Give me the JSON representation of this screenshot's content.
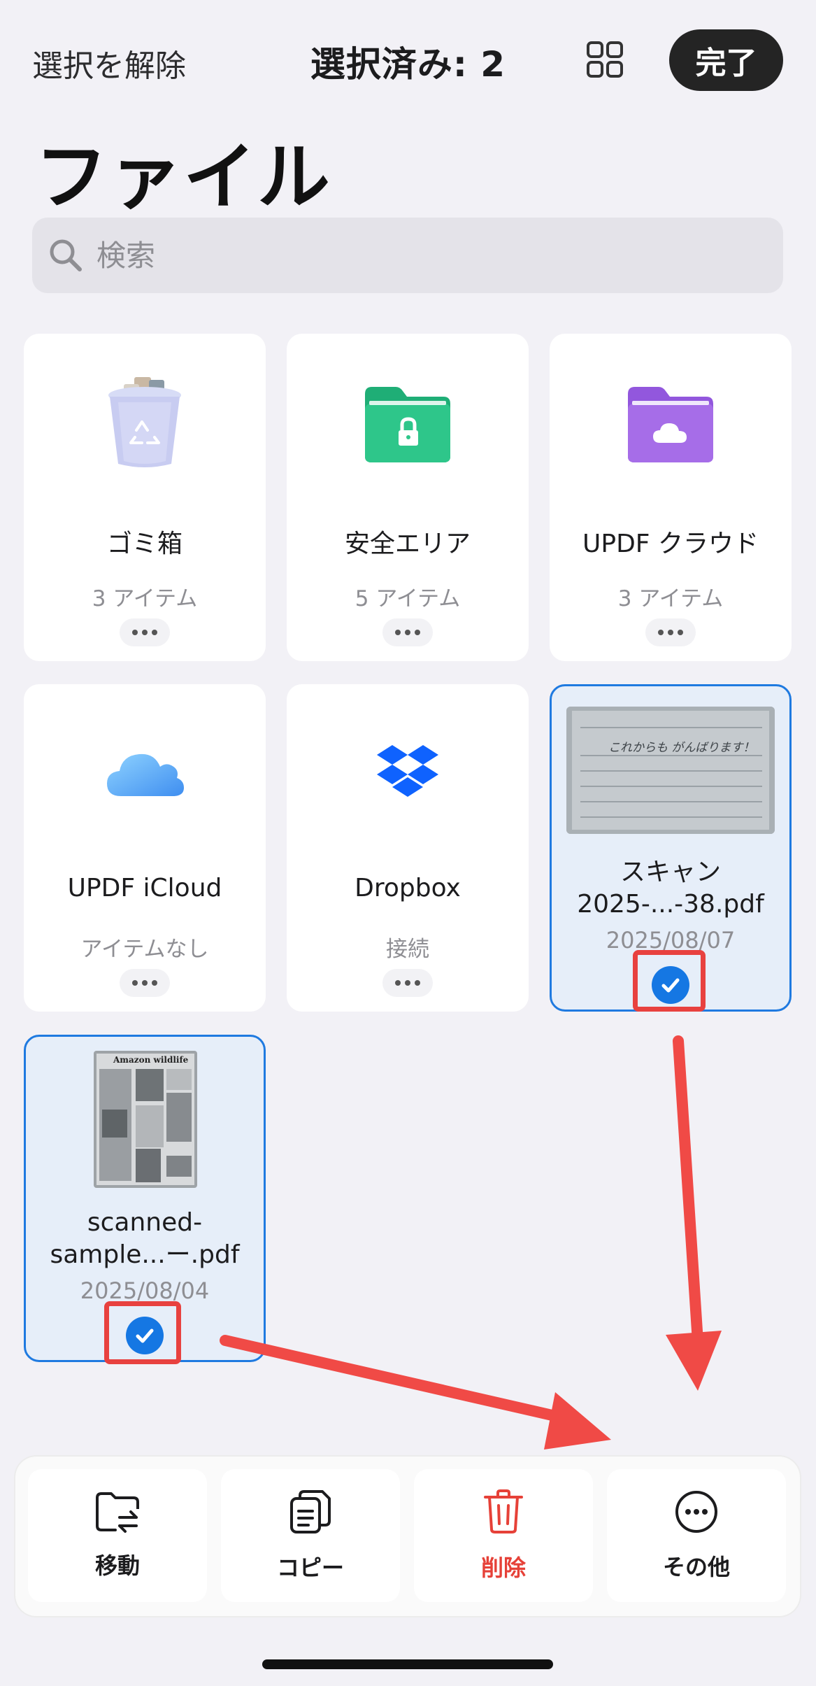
{
  "header": {
    "deselect_label": "選択を解除",
    "selection_count": "選択済み: 2",
    "grid_icon": "grid-view-icon",
    "done_label": "完了"
  },
  "page": {
    "title": "ファイル"
  },
  "search": {
    "placeholder": "検索",
    "icon": "search-icon"
  },
  "folders": [
    {
      "name": "ゴミ箱",
      "sub": "3 アイテム",
      "icon": "trash-icon"
    },
    {
      "name": "安全エリア",
      "sub": "5 アイテム",
      "icon": "secure-folder-icon"
    },
    {
      "name": "UPDF クラウド",
      "sub": "3 アイテム",
      "icon": "cloud-folder-icon"
    },
    {
      "name": "UPDF iCloud",
      "sub": "アイテムなし",
      "icon": "icloud-icon"
    },
    {
      "name": "Dropbox",
      "sub": "接続",
      "icon": "dropbox-icon"
    }
  ],
  "files": [
    {
      "name_line1": "スキャン",
      "name_line2": "2025-...-38.pdf",
      "date": "2025/08/07",
      "thumb_text": "これからも がんばります！",
      "selected": true
    },
    {
      "name_line1": "scanned-",
      "name_line2": "sample...ー.pdf",
      "date": "2025/08/04",
      "thumb_text": "Amazon wildlife",
      "selected": true
    }
  ],
  "toolbar": {
    "move_label": "移動",
    "copy_label": "コピー",
    "delete_label": "削除",
    "more_label": "その他"
  },
  "colors": {
    "accent": "#1577e3",
    "danger": "#e64138",
    "annotation": "#e8413f",
    "secure_folder": "#2ec68a",
    "cloud_folder": "#a66de8"
  }
}
